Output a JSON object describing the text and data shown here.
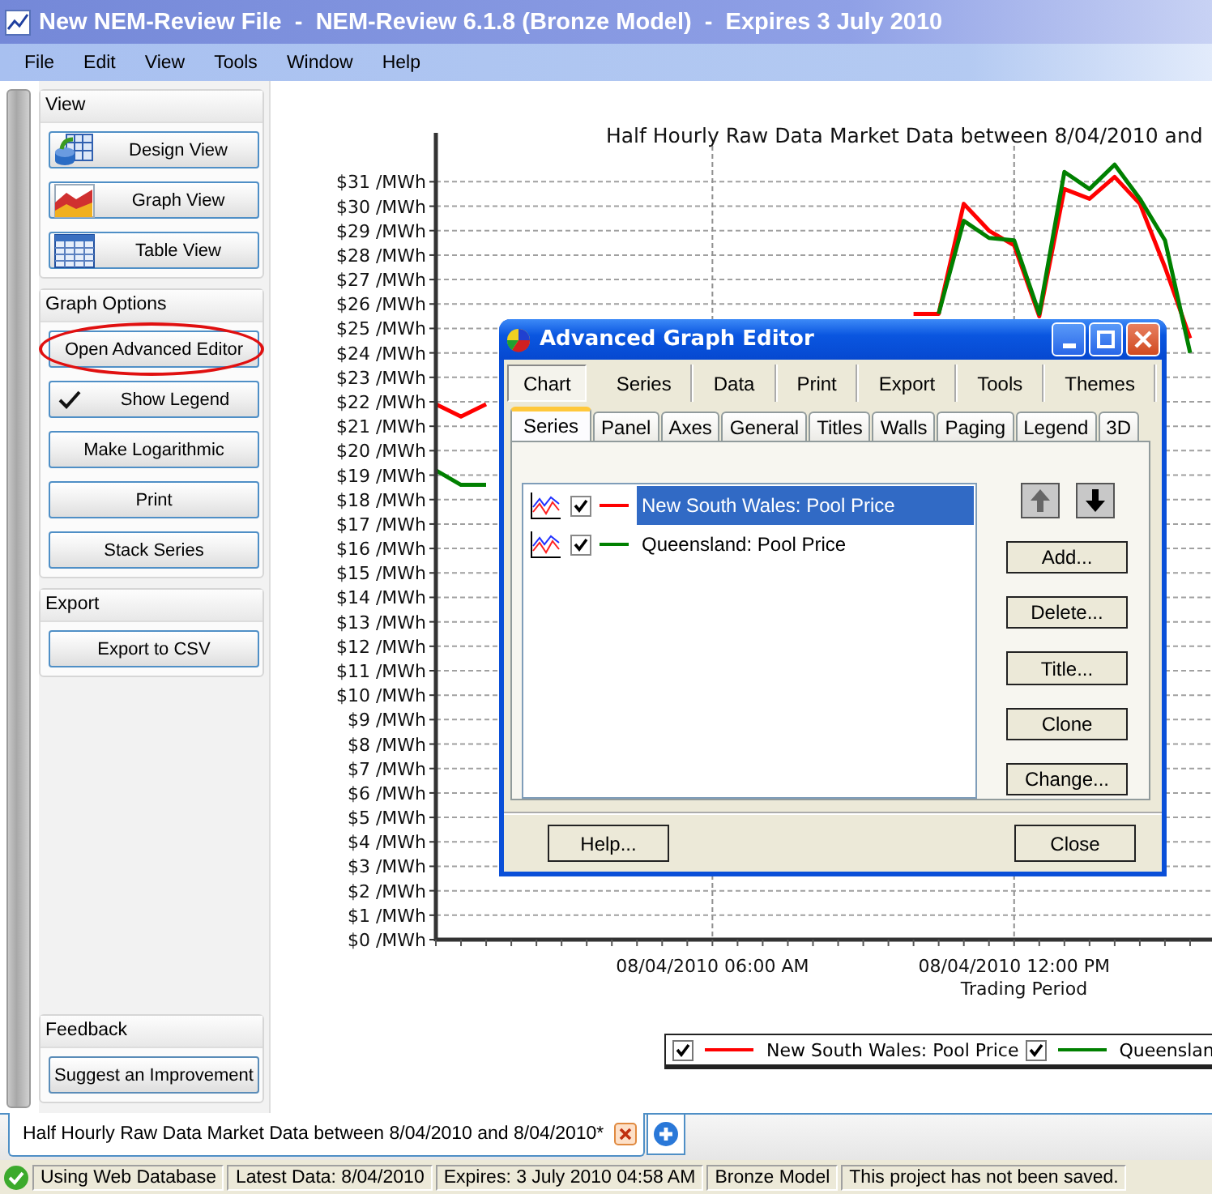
{
  "window": {
    "title": "New NEM-Review File  -  NEM-Review 6.1.8 (Bronze Model)  -  Expires 3 July 2010"
  },
  "menu": [
    "File",
    "Edit",
    "View",
    "Tools",
    "Window",
    "Help"
  ],
  "sidebar": {
    "groups": [
      {
        "title": "View",
        "buttons": [
          {
            "label": "Design View",
            "kind": "design",
            "highlighted": false
          },
          {
            "label": "Graph View",
            "kind": "graph",
            "highlighted": false
          },
          {
            "label": "Table View",
            "kind": "table",
            "highlighted": false
          }
        ]
      },
      {
        "title": "Graph Options",
        "buttons": [
          {
            "label": "Open Advanced Editor",
            "kind": "plain",
            "highlighted": true
          },
          {
            "label": "Show Legend",
            "kind": "toggle",
            "checked": true,
            "highlighted": false
          },
          {
            "label": "Make Logarithmic",
            "kind": "plain",
            "highlighted": false
          },
          {
            "label": "Print",
            "kind": "plain",
            "highlighted": false
          },
          {
            "label": "Stack Series",
            "kind": "plain",
            "highlighted": false
          }
        ]
      },
      {
        "title": "Export",
        "buttons": [
          {
            "label": "Export to CSV",
            "kind": "plain",
            "highlighted": false
          }
        ]
      }
    ],
    "footer_group": {
      "title": "Feedback",
      "buttons": [
        {
          "label": "Suggest an Improvement",
          "highlighted": false
        }
      ]
    }
  },
  "chart": {
    "chart_data": {
      "type": "line",
      "title": "Half Hourly Raw Data Market Data between 8/04/2010 and",
      "xlabel": "Trading Period",
      "categories": [
        null,
        null,
        null,
        null,
        null,
        null,
        null,
        null,
        null,
        null,
        null,
        "08/04/2010 06:00 AM",
        null,
        null,
        null,
        null,
        null,
        null,
        null,
        null,
        null,
        null,
        null,
        "08/04/2010 12:00 PM",
        null,
        null,
        null,
        null,
        null,
        null,
        null,
        null
      ],
      "series": [
        {
          "color": "#ff0000",
          "values": [
            21.9,
            21.4,
            21.9,
            null,
            null,
            null,
            null,
            null,
            null,
            null,
            null,
            null,
            null,
            null,
            null,
            null,
            null,
            null,
            null,
            25.6,
            25.6,
            30.1,
            29.0,
            28.4,
            25.5,
            30.7,
            30.3,
            31.2,
            30.1,
            27.5,
            24.6,
            null
          ]
        },
        {
          "color": "#008000",
          "values": [
            19.2,
            18.6,
            18.6,
            null,
            null,
            null,
            null,
            null,
            null,
            null,
            null,
            null,
            null,
            null,
            null,
            null,
            null,
            null,
            null,
            null,
            25.6,
            29.4,
            28.7,
            28.6,
            25.6,
            31.4,
            30.7,
            31.7,
            30.3,
            28.6,
            24.0,
            null
          ]
        }
      ],
      "ylim": [
        0,
        33
      ],
      "grid": true,
      "yticks": [
        {
          "value": 0,
          "label": "$0 /MWh"
        },
        {
          "value": 1,
          "label": "$1 /MWh"
        },
        {
          "value": 2,
          "label": "$2 /MWh"
        },
        {
          "value": 3,
          "label": "$3 /MWh"
        },
        {
          "value": 4,
          "label": "$4 /MWh"
        },
        {
          "value": 5,
          "label": "$5 /MWh"
        },
        {
          "value": 6,
          "label": "$6 /MWh"
        },
        {
          "value": 7,
          "label": "$7 /MWh"
        },
        {
          "value": 8,
          "label": "$8 /MWh"
        },
        {
          "value": 9,
          "label": "$9 /MWh"
        },
        {
          "value": 10,
          "label": "$10 /MWh"
        },
        {
          "value": 11,
          "label": "$11 /MWh"
        },
        {
          "value": 12,
          "label": "$12 /MWh"
        },
        {
          "value": 13,
          "label": "$13 /MWh"
        },
        {
          "value": 14,
          "label": "$14 /MWh"
        },
        {
          "value": 15,
          "label": "$15 /MWh"
        },
        {
          "value": 16,
          "label": "$16 /MWh"
        },
        {
          "value": 17,
          "label": "$17 /MWh"
        },
        {
          "value": 18,
          "label": "$18 /MWh"
        },
        {
          "value": 19,
          "label": "$19 /MWh"
        },
        {
          "value": 20,
          "label": "$20 /MWh"
        },
        {
          "value": 21,
          "label": "$21 /MWh"
        },
        {
          "value": 22,
          "label": "$22 /MWh"
        },
        {
          "value": 23,
          "label": "$23 /MWh"
        },
        {
          "value": 24,
          "label": "$24 /MWh"
        },
        {
          "value": 25,
          "label": "$25 /MWh"
        },
        {
          "value": 26,
          "label": "$26 /MWh"
        },
        {
          "value": 27,
          "label": "$27 /MWh"
        },
        {
          "value": 28,
          "label": "$28 /MWh"
        },
        {
          "value": 29,
          "label": "$29 /MWh"
        },
        {
          "value": 30,
          "label": "$30 /MWh"
        },
        {
          "value": 31,
          "label": "$31 /MWh"
        }
      ]
    },
    "legend": [
      {
        "label": "New South Wales: Pool Price",
        "checked": true,
        "color": "#ff0000"
      },
      {
        "label": "Queenslan",
        "checked": true,
        "color": "#008000"
      }
    ]
  },
  "dialog": {
    "title": "Advanced Graph Editor",
    "tabs": [
      {
        "label": "Chart",
        "selected": true
      },
      {
        "label": "Series",
        "selected": false
      },
      {
        "label": "Data",
        "selected": false
      },
      {
        "label": "Print",
        "selected": false
      },
      {
        "label": "Export",
        "selected": false
      },
      {
        "label": "Tools",
        "selected": false
      },
      {
        "label": "Themes",
        "selected": false
      }
    ],
    "subtabs": [
      {
        "label": "Series",
        "selected": true
      },
      {
        "label": "Panel",
        "selected": false
      },
      {
        "label": "Axes",
        "selected": false
      },
      {
        "label": "General",
        "selected": false
      },
      {
        "label": "Titles",
        "selected": false
      },
      {
        "label": "Walls",
        "selected": false
      },
      {
        "label": "Paging",
        "selected": false
      },
      {
        "label": "Legend",
        "selected": false
      },
      {
        "label": "3D",
        "selected": false
      }
    ],
    "series_list": [
      {
        "label": "New South Wales: Pool Price",
        "checked": true,
        "selected": true,
        "color": "#ff0000"
      },
      {
        "label": "Queensland: Pool Price",
        "checked": true,
        "selected": false,
        "color": "#008000"
      }
    ],
    "buttons": [
      "Add...",
      "Delete...",
      "Title...",
      "Clone",
      "Change..."
    ],
    "footer_buttons": [
      "Help...",
      "Close"
    ]
  },
  "document_tabs": [
    {
      "label": "Half Hourly Raw Data Market Data between 8/04/2010 and 8/04/2010*",
      "selected": true
    }
  ],
  "status_bar": {
    "items": [
      "Using Web Database",
      "Latest Data: 8/04/2010",
      "Expires: 3 July 2010 04:58 AM",
      "Bronze Model",
      "This project has not been saved."
    ]
  }
}
